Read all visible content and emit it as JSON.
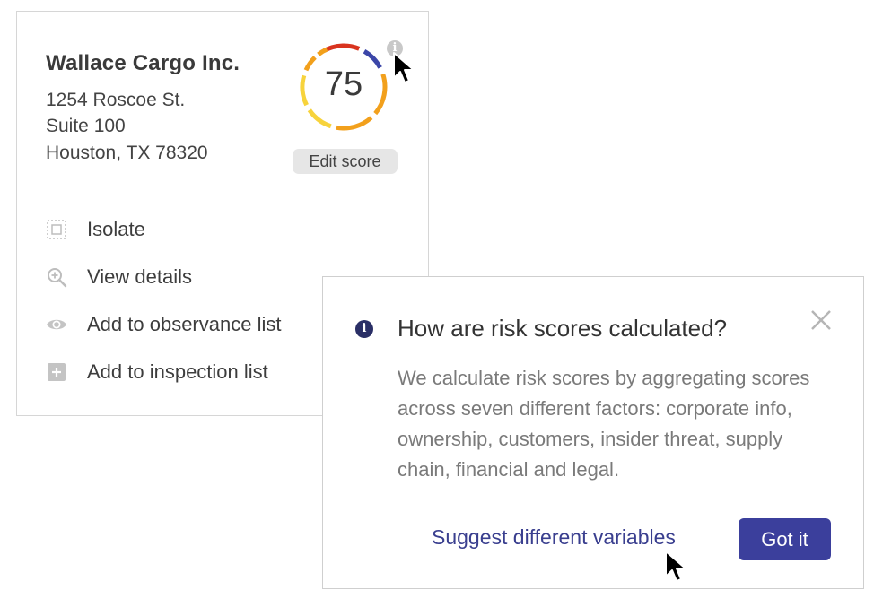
{
  "company": {
    "name": "Wallace Cargo Inc.",
    "address_line1": "1254 Roscoe St.",
    "address_line2": "Suite 100",
    "address_line3": "Houston, TX 78320"
  },
  "score": {
    "value": "75",
    "edit_label": "Edit score",
    "info_glyph": "i",
    "colors": {
      "red": "#d9341f",
      "orange": "#f2a01c",
      "yellow": "#f7d33c",
      "blue": "#3b46a8"
    }
  },
  "menu": [
    {
      "label": "Isolate",
      "icon": "isolate-icon"
    },
    {
      "label": "View details",
      "icon": "zoom-in-icon"
    },
    {
      "label": "Add to observance list",
      "icon": "eye-icon"
    },
    {
      "label": "Add to inspection list",
      "icon": "plus-square-icon"
    }
  ],
  "popover": {
    "title": "How are risk scores calculated?",
    "body": "We calculate risk scores by aggregating scores across seven different factors: corporate info, ownership, customers, insider threat, supply chain, financial and legal.",
    "info_glyph": "i",
    "secondary_action": "Suggest different variables",
    "primary_action": "Got it",
    "accent": "#3b3f9c"
  }
}
